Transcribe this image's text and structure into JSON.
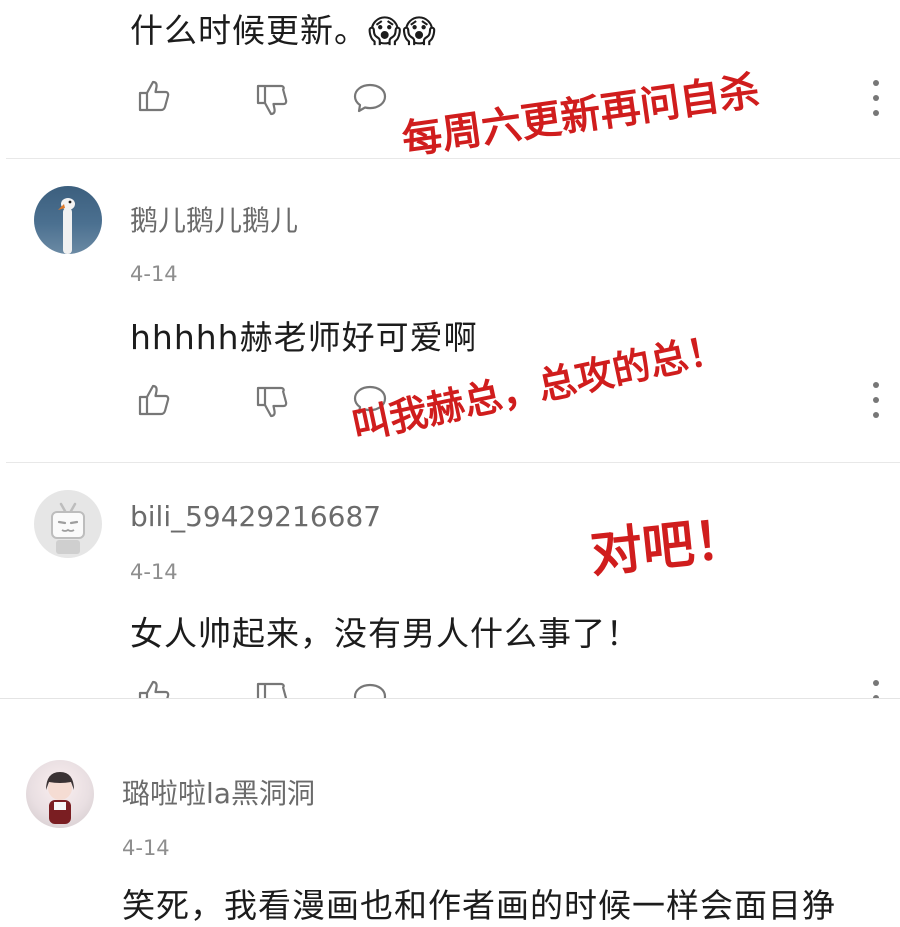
{
  "comments": [
    {
      "text": "什么时候更新。",
      "emoji": "😱😱",
      "annotation": "每周六更新再问自杀"
    },
    {
      "username": "鹅儿鹅儿鹅儿",
      "date": "4-14",
      "text": "hhhhh赫老师好可爱啊",
      "avatar": "swan-avatar",
      "annotation": "叫我赫总，总攻的总！"
    },
    {
      "username": "bili_59429216687",
      "date": "4-14",
      "text": "女人帅起来，没有男人什么事了！",
      "avatar": "bilibili-default-avatar",
      "annotation": "对吧！"
    },
    {
      "username": "璐啦啦la黑洞洞",
      "date": "4-14",
      "text": "笑死，我看漫画也和作者画的时候一样会面目狰",
      "avatar": "girl-avatar"
    }
  ],
  "colors": {
    "annotation": "#d01d1d",
    "divider": "#e8e8e8",
    "icon": "#777777"
  },
  "icons": [
    "thumb-up-icon",
    "thumb-down-icon",
    "comment-icon",
    "more-vertical-icon"
  ]
}
